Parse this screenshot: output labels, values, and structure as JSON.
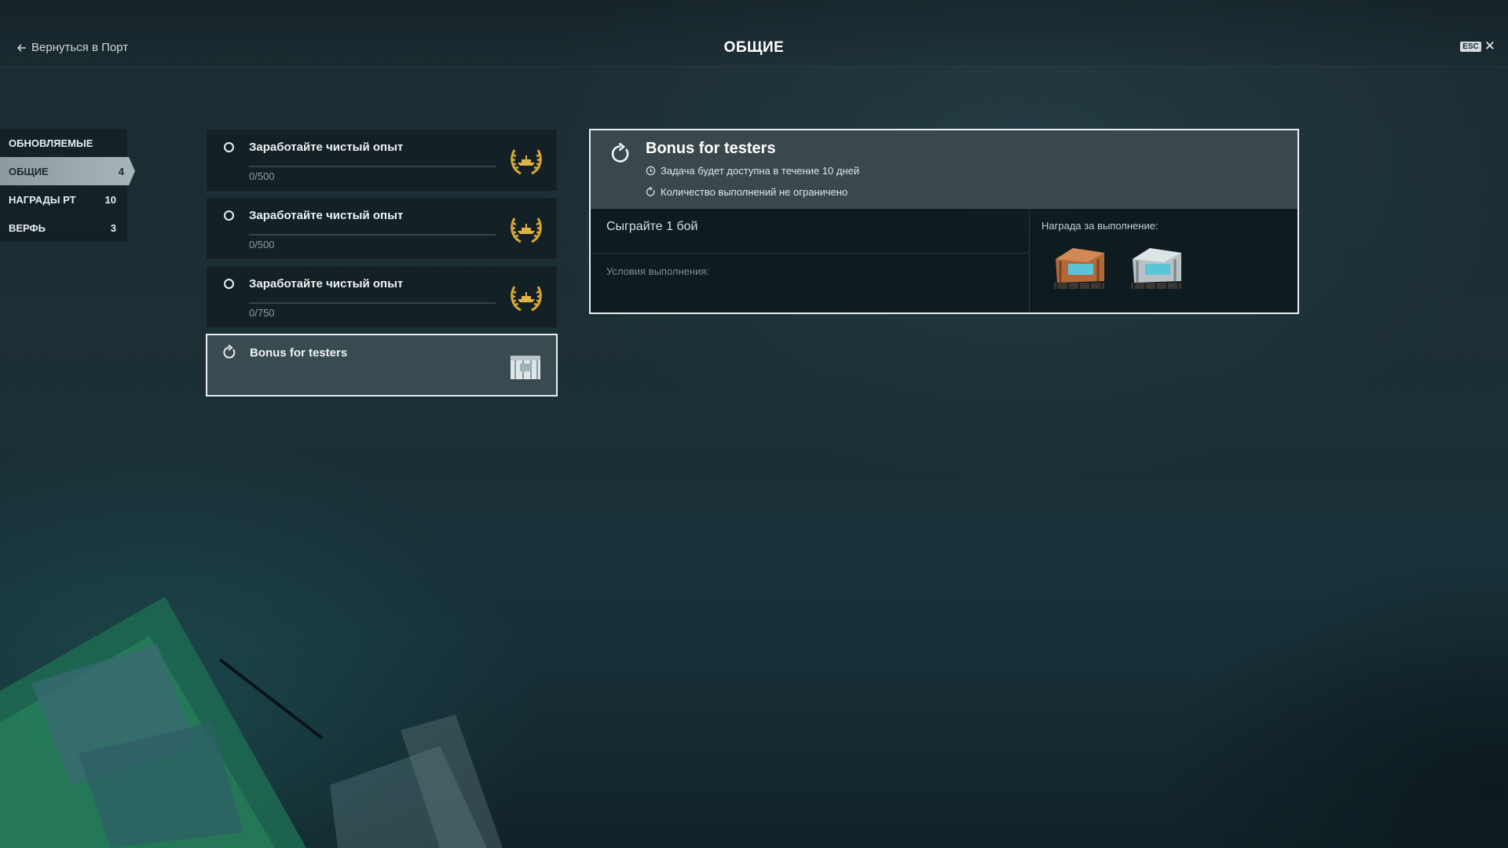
{
  "header": {
    "back_label": "Вернуться в Порт",
    "title": "ОБЩИЕ",
    "esc_label": "ESC"
  },
  "sidebar": {
    "items": [
      {
        "label": "ОБНОВЛЯЕМЫЕ",
        "count": ""
      },
      {
        "label": "ОБЩИЕ",
        "count": "4"
      },
      {
        "label": "НАГРАДЫ РТ",
        "count": "10"
      },
      {
        "label": "ВЕРФЬ",
        "count": "3"
      }
    ]
  },
  "quests": [
    {
      "title": "Заработайте чистый опыт",
      "progress": "0/500",
      "progress_fraction": 0
    },
    {
      "title": "Заработайте чистый опыт",
      "progress": "0/500",
      "progress_fraction": 0
    },
    {
      "title": "Заработайте чистый опыт",
      "progress": "0/750",
      "progress_fraction": 0
    },
    {
      "title": "Bonus for testers"
    }
  ],
  "detail": {
    "title": "Bonus for testers",
    "availability": "Задача будет доступна в течение 10 дней",
    "repeat": "Количество выполнений не ограничено",
    "task": "Сыграйте 1 бой",
    "conditions_label": "Условия выполнения:",
    "reward_label": "Награда за выполнение:"
  },
  "colors": {
    "accent_gold": "#d9a73a",
    "selected_border": "#e9eef0",
    "active_tab": "#a8b4b8"
  }
}
